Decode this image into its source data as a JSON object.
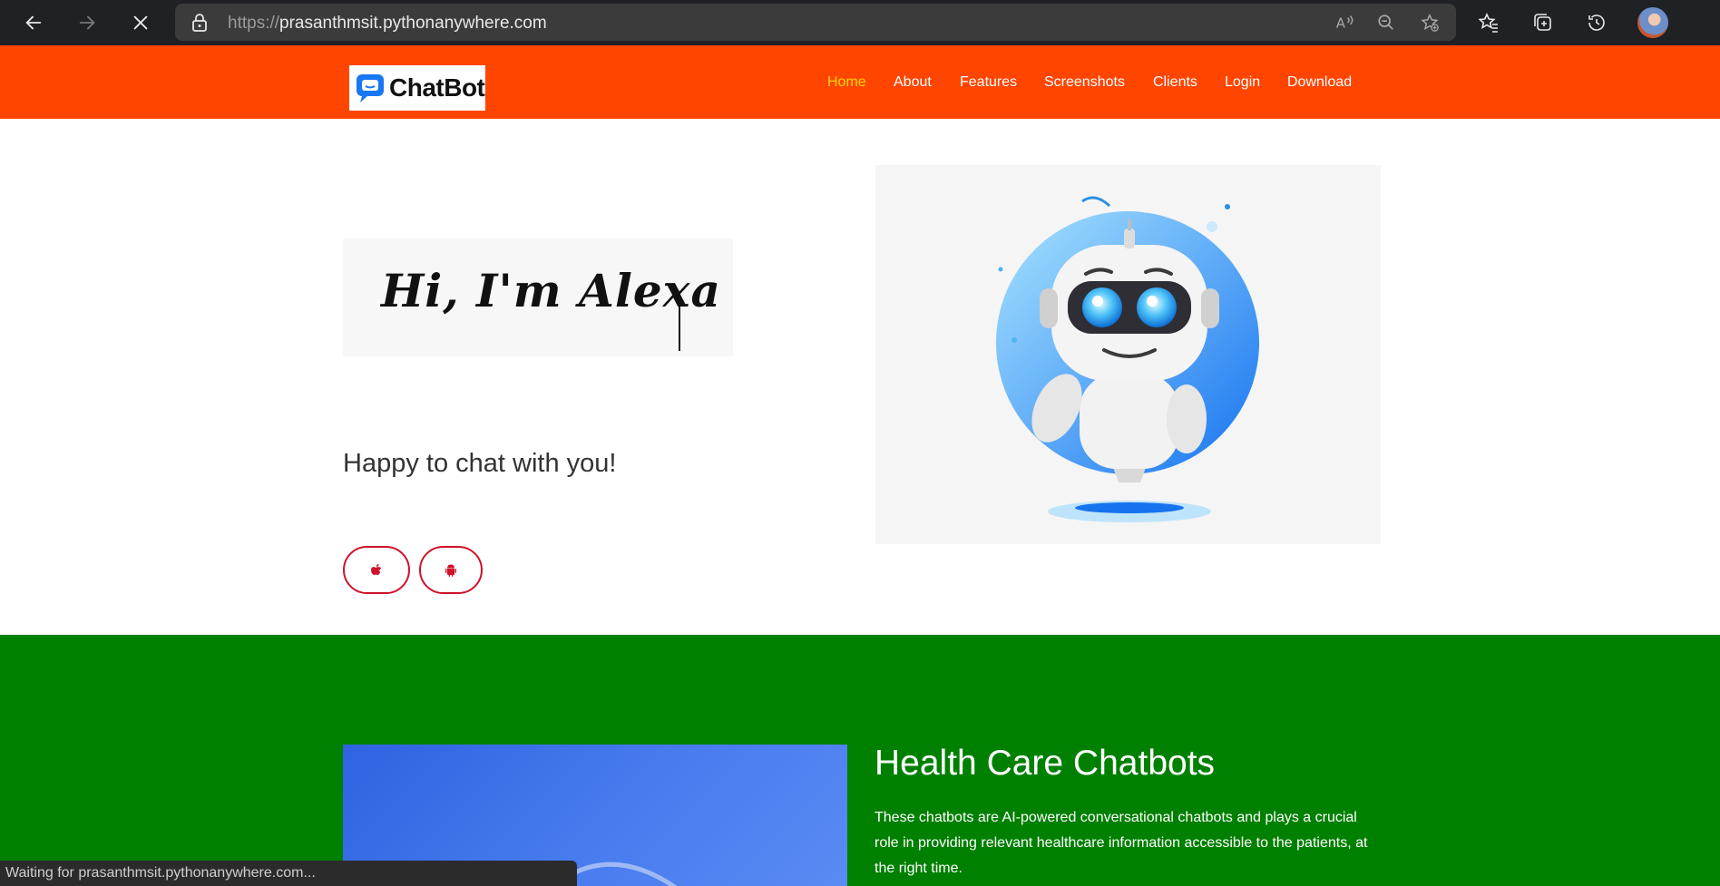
{
  "browser": {
    "url_scheme": "https://",
    "url_host": "prasanthmsit.pythonanywhere.com",
    "status_text": "Waiting for prasanthmsit.pythonanywhere.com..."
  },
  "site": {
    "logo_text": "ChatBot",
    "nav": [
      {
        "label": "Home",
        "active": true
      },
      {
        "label": "About"
      },
      {
        "label": "Features"
      },
      {
        "label": "Screenshots"
      },
      {
        "label": "Clients"
      },
      {
        "label": "Login"
      },
      {
        "label": "Download"
      }
    ],
    "colors": {
      "header": "#ff4500",
      "active_nav": "#ffd700",
      "green": "#008000",
      "accent": "#d0112b"
    }
  },
  "hero": {
    "greeting": "Hi, I'm Alexa",
    "subtitle": "Happy to chat with you!",
    "buttons": [
      {
        "icon": "apple-icon"
      },
      {
        "icon": "android-icon"
      }
    ]
  },
  "health": {
    "title": "Health Care Chatbots",
    "text": "These chatbots are AI-powered conversational chatbots and plays a crucial role in providing relevant healthcare information accessible to the patients, at the right time."
  }
}
